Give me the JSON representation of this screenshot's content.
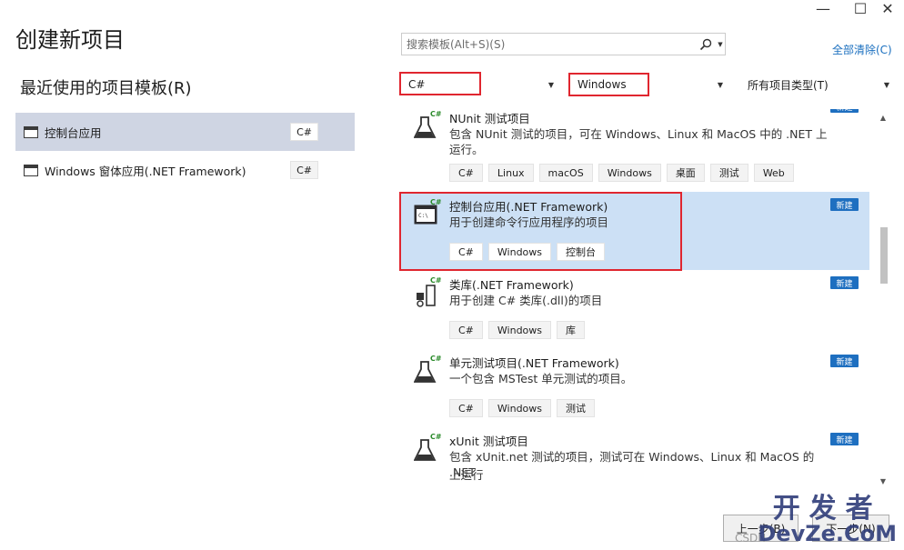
{
  "window": {
    "minimize_glyph": "—",
    "maximize_glyph": "☐",
    "close_glyph": "✕"
  },
  "page_title": "创建新项目",
  "recent": {
    "title": "最近使用的项目模板(R)",
    "items": [
      {
        "label": "控制台应用",
        "lang": "C#"
      },
      {
        "label": "Windows 窗体应用(.NET Framework)",
        "lang": "C#"
      }
    ]
  },
  "search": {
    "placeholder": "搜索模板(Alt+S)(S)",
    "icon": "search-icon"
  },
  "clear_all": "全部清除(C)",
  "filters": {
    "language": "C#",
    "platform": "Windows",
    "project_type": "所有项目类型(T)"
  },
  "templates": [
    {
      "name": "NUnit 测试项目",
      "description": "包含 NUnit 测试的项目，可在 Windows、Linux 和 MacOS 中的 .NET 上运行。",
      "tags": [
        "C#",
        "Linux",
        "macOS",
        "Windows",
        "桌面",
        "测试",
        "Web"
      ],
      "badge": "新建",
      "icon": "flask-icon"
    },
    {
      "name": "控制台应用(.NET Framework)",
      "description": "用于创建命令行应用程序的项目",
      "tags": [
        "C#",
        "Windows",
        "控制台"
      ],
      "badge": "新建",
      "icon": "console-icon"
    },
    {
      "name": "类库(.NET Framework)",
      "description": "用于创建 C# 类库(.dll)的项目",
      "tags": [
        "C#",
        "Windows",
        "库"
      ],
      "badge": "新建",
      "icon": "class-library-icon"
    },
    {
      "name": "单元测试项目(.NET Framework)",
      "description": "一个包含 MSTest 单元测试的项目。",
      "tags": [
        "C#",
        "Windows",
        "测试"
      ],
      "badge": "新建",
      "icon": "flask-icon"
    },
    {
      "name": "xUnit 测试项目",
      "description": "包含 xUnit.net 测试的项目，测试可在 Windows、Linux 和 MacOS 的 .NET",
      "description_tail": "上运行",
      "tags": [],
      "badge": "新建",
      "icon": "flask-icon"
    }
  ],
  "buttons": {
    "back": "上一步(B)",
    "next": "下一步(N)"
  },
  "watermark": {
    "cn": "开发者",
    "en": "DevZe.CoM",
    "csdn": "CSDN"
  },
  "colors": {
    "accent": "#1e6fc0",
    "selected_row": "#cce0f5",
    "highlight_box": "#e0262f"
  }
}
